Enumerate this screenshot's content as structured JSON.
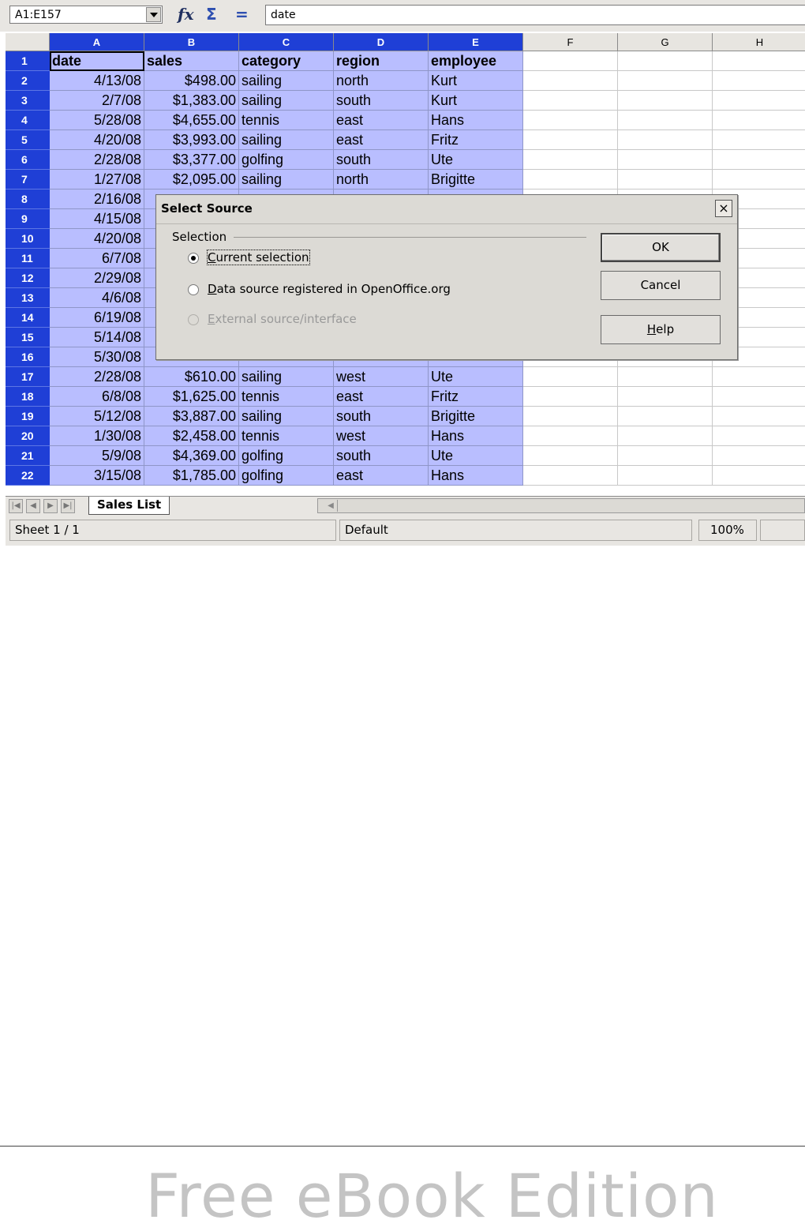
{
  "formula_bar": {
    "name_box": "A1:E157",
    "fx_icon": "function-wizard-icon",
    "sum_icon": "sum-icon",
    "equals_icon": "formula-icon",
    "fx_glyph": "fx",
    "sum_glyph": "Σ",
    "equals_glyph": "=",
    "formula": "date"
  },
  "columns": [
    "A",
    "B",
    "C",
    "D",
    "E",
    "F",
    "G",
    "H"
  ],
  "selected_columns": [
    "A",
    "B",
    "C",
    "D",
    "E"
  ],
  "rows": [
    {
      "n": "1",
      "cells": [
        "date",
        "sales",
        "category",
        "region",
        "employee"
      ]
    },
    {
      "n": "2",
      "cells": [
        "4/13/08",
        "$498.00",
        "sailing",
        "north",
        "Kurt"
      ]
    },
    {
      "n": "3",
      "cells": [
        "2/7/08",
        "$1,383.00",
        "sailing",
        "south",
        "Kurt"
      ]
    },
    {
      "n": "4",
      "cells": [
        "5/28/08",
        "$4,655.00",
        "tennis",
        "east",
        "Hans"
      ]
    },
    {
      "n": "5",
      "cells": [
        "4/20/08",
        "$3,993.00",
        "sailing",
        "east",
        "Fritz"
      ]
    },
    {
      "n": "6",
      "cells": [
        "2/28/08",
        "$3,377.00",
        "golfing",
        "south",
        "Ute"
      ]
    },
    {
      "n": "7",
      "cells": [
        "1/27/08",
        "$2,095.00",
        "sailing",
        "north",
        "Brigitte"
      ]
    },
    {
      "n": "8",
      "cells": [
        "2/16/08",
        "",
        "",
        "",
        ""
      ]
    },
    {
      "n": "9",
      "cells": [
        "4/15/08",
        "",
        "",
        "",
        ""
      ]
    },
    {
      "n": "10",
      "cells": [
        "4/20/08",
        "",
        "",
        "",
        ""
      ]
    },
    {
      "n": "11",
      "cells": [
        "6/7/08",
        "",
        "",
        "",
        ""
      ]
    },
    {
      "n": "12",
      "cells": [
        "2/29/08",
        "",
        "",
        "",
        ""
      ]
    },
    {
      "n": "13",
      "cells": [
        "4/6/08",
        "",
        "",
        "",
        ""
      ]
    },
    {
      "n": "14",
      "cells": [
        "6/19/08",
        "",
        "",
        "",
        ""
      ]
    },
    {
      "n": "15",
      "cells": [
        "5/14/08",
        "",
        "",
        "",
        ""
      ]
    },
    {
      "n": "16",
      "cells": [
        "5/30/08",
        "",
        "",
        "",
        ""
      ]
    },
    {
      "n": "17",
      "cells": [
        "2/28/08",
        "$610.00",
        "sailing",
        "west",
        "Ute"
      ]
    },
    {
      "n": "18",
      "cells": [
        "6/8/08",
        "$1,625.00",
        "tennis",
        "east",
        "Fritz"
      ]
    },
    {
      "n": "19",
      "cells": [
        "5/12/08",
        "$3,887.00",
        "sailing",
        "south",
        "Brigitte"
      ]
    },
    {
      "n": "20",
      "cells": [
        "1/30/08",
        "$2,458.00",
        "tennis",
        "west",
        "Hans"
      ]
    },
    {
      "n": "21",
      "cells": [
        "5/9/08",
        "$4,369.00",
        "golfing",
        "south",
        "Ute"
      ]
    },
    {
      "n": "22",
      "cells": [
        "3/15/08",
        "$1,785.00",
        "golfing",
        "east",
        "Hans"
      ]
    }
  ],
  "sheet_tab": "Sales List",
  "status_bar": {
    "sheet": "Sheet 1 / 1",
    "style": "Default",
    "zoom": "100%"
  },
  "dialog": {
    "title": "Select Source",
    "close_glyph": "×",
    "group_label": "Selection",
    "options": [
      {
        "label_accel": "C",
        "label_rest": "urrent selection",
        "checked": true,
        "enabled": true
      },
      {
        "label_accel": "D",
        "label_rest": "ata source registered in OpenOffice.org",
        "checked": false,
        "enabled": true
      },
      {
        "label_accel": "E",
        "label_rest": "xternal source/interface",
        "checked": false,
        "enabled": false
      }
    ],
    "ok_label": "OK",
    "cancel_label": "Cancel",
    "help_accel": "H",
    "help_rest": "elp"
  },
  "footer": "Free eBook Edition"
}
